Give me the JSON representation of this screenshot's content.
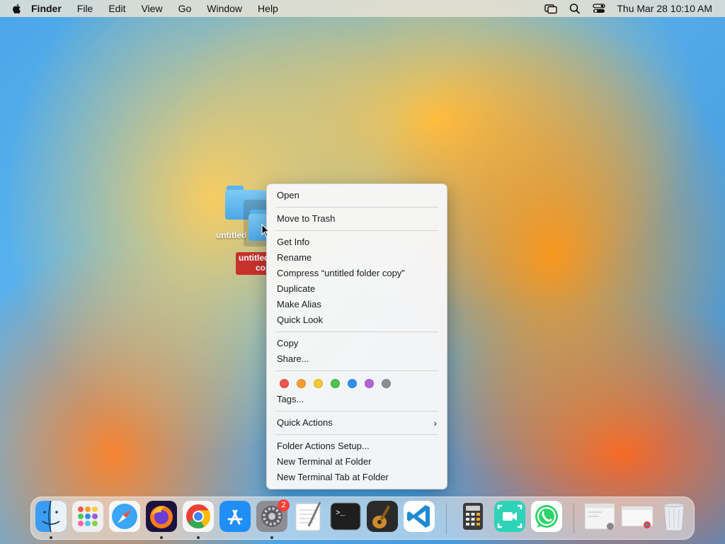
{
  "menubar": {
    "app_name": "Finder",
    "menus": [
      "File",
      "Edit",
      "View",
      "Go",
      "Window",
      "Help"
    ],
    "clock": "Thu Mar 28  10:10 AM"
  },
  "desktop": {
    "folder1_label": "untitled folder",
    "folder2_label_line1": "untitled folder",
    "folder2_label_line2": "copy"
  },
  "context_menu": {
    "open": "Open",
    "move_to_trash": "Move to Trash",
    "get_info": "Get Info",
    "rename": "Rename",
    "compress": "Compress “untitled folder copy”",
    "duplicate": "Duplicate",
    "make_alias": "Make Alias",
    "quick_look": "Quick Look",
    "copy": "Copy",
    "share": "Share...",
    "tag_colors": [
      "#ee5550",
      "#f59c32",
      "#f5c932",
      "#4dc24d",
      "#2e8ff0",
      "#b064d8",
      "#8e8e8e"
    ],
    "tags": "Tags...",
    "quick_actions": "Quick Actions",
    "folder_actions_setup": "Folder Actions Setup...",
    "new_terminal_at_folder": "New Terminal at Folder",
    "new_terminal_tab_at_folder": "New Terminal Tab at Folder"
  },
  "dock": {
    "apps": [
      "finder",
      "launchpad",
      "safari",
      "firefox",
      "chrome",
      "app-store",
      "system-settings",
      "textedit",
      "terminal",
      "garageband",
      "vscode",
      "calculator",
      "facetime",
      "whatsapp"
    ],
    "system_settings_badge": "2"
  }
}
